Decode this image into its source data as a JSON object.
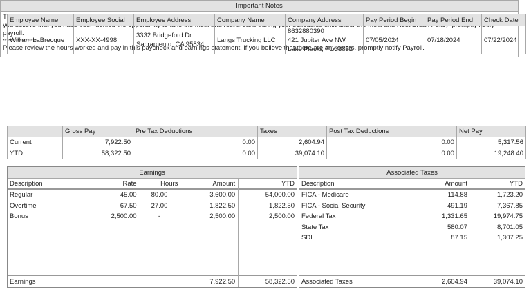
{
  "info": {
    "headers": [
      "Employee Name",
      "Employee Social",
      "Employee Address",
      "Company Name",
      "Company Address",
      "Pay Period Begin",
      "Pay Period End",
      "Check Date"
    ],
    "employee_name": "William LaBrecque",
    "employee_social": "XXX-XX-4998",
    "employee_address_1": "3332 Bridgeford Dr",
    "employee_address_2": "Sacramento, CA 95834",
    "company_name": "Langs Trucking LLC",
    "company_phone": "8632880390",
    "company_address_1": "421 Jupiter Ave NW",
    "company_address_2": "Lake Placid, FL 33852",
    "pay_period_begin": "07/05/2024",
    "pay_period_end": "07/18/2024",
    "check_date": "07/22/2024"
  },
  "notes": {
    "title": "Important Notes",
    "line1": "The Meal and Rest Break Policy provides you with the opportunity to take meal and rest breaks. As provided in the Meal and Rest Break Policy, requirements vary by state. If you believe that you have been denied the opportunity to take the meal and rest breaks during your scheduled shift under the Meal and Rest Break Policy, promptly notify payroll.",
    "stars": "******************",
    "line2": "Please review the hours worked and pay in this paycheck and earnings statement, if you believe that there are any errors, promptly notify Payroll."
  },
  "summary": {
    "headers": [
      "",
      "Gross Pay",
      "Pre Tax Deductions",
      "Taxes",
      "Post Tax Deductions",
      "Net Pay"
    ],
    "rows": [
      [
        "Current",
        "7,922.50",
        "0.00",
        "2,604.94",
        "0.00",
        "5,317.56"
      ],
      [
        "YTD",
        "58,322.50",
        "0.00",
        "39,074.10",
        "0.00",
        "19,248.40"
      ]
    ]
  },
  "earnings": {
    "title": "Earnings",
    "headers": [
      "Description",
      "Rate",
      "Hours",
      "Amount",
      "YTD"
    ],
    "rows": [
      [
        "Regular",
        "45.00",
        "80.00",
        "3,600.00",
        "54,000.00"
      ],
      [
        "Overtime",
        "67.50",
        "27.00",
        "1,822.50",
        "1,822.50"
      ],
      [
        "Bonus",
        "2,500.00",
        "-",
        "2,500.00",
        "2,500.00"
      ]
    ],
    "footer": {
      "label": "Earnings",
      "amount": "7,922.50",
      "ytd": "58,322.50"
    }
  },
  "taxes": {
    "title": "Associated Taxes",
    "headers": [
      "Description",
      "Amount",
      "YTD"
    ],
    "rows": [
      [
        "FICA - Medicare",
        "114.88",
        "1,723.20"
      ],
      [
        "FICA - Social Security",
        "491.19",
        "7,367.85"
      ],
      [
        "Federal Tax",
        "1,331.65",
        "19,974.75"
      ],
      [
        "State Tax",
        "580.07",
        "8,701.05"
      ],
      [
        "SDI",
        "87.15",
        "1,307.25"
      ]
    ],
    "footer": {
      "label": "Associated Taxes",
      "amount": "2,604.94",
      "ytd": "39,074.10"
    }
  }
}
